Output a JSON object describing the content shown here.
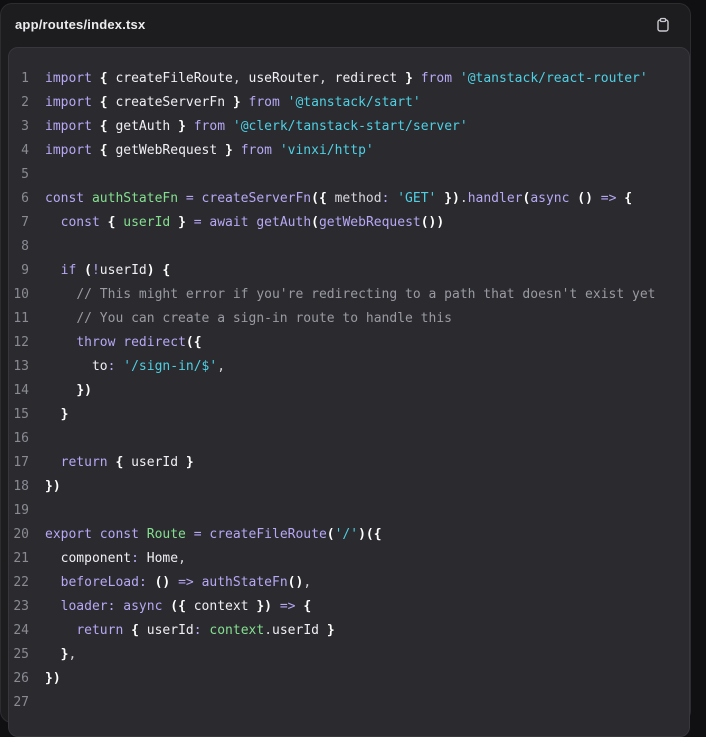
{
  "header": {
    "filename": "app/routes/index.tsx",
    "copy_icon": "clipboard-icon"
  },
  "colors": {
    "keyword": "#b8a8f5",
    "string": "#4fd0e3",
    "comment": "#9a9aa3",
    "variable": "#84e08f",
    "plain": "#d6d6dc",
    "background": "#2a2a2f"
  },
  "code": {
    "lines": [
      {
        "n": "1",
        "tokens": [
          [
            "kw",
            "import "
          ],
          [
            "br",
            "{ "
          ],
          [
            "fn",
            "createFileRoute"
          ],
          [
            "pl",
            ", "
          ],
          [
            "fn",
            "useRouter"
          ],
          [
            "pl",
            ", "
          ],
          [
            "fn",
            "redirect "
          ],
          [
            "br",
            "} "
          ],
          [
            "kw",
            "from "
          ],
          [
            "str",
            "'@tanstack/react-router'"
          ]
        ]
      },
      {
        "n": "2",
        "tokens": [
          [
            "kw",
            "import "
          ],
          [
            "br",
            "{ "
          ],
          [
            "fn",
            "createServerFn "
          ],
          [
            "br",
            "} "
          ],
          [
            "kw",
            "from "
          ],
          [
            "str",
            "'@tanstack/start'"
          ]
        ]
      },
      {
        "n": "3",
        "tokens": [
          [
            "kw",
            "import "
          ],
          [
            "br",
            "{ "
          ],
          [
            "fn",
            "getAuth "
          ],
          [
            "br",
            "} "
          ],
          [
            "kw",
            "from "
          ],
          [
            "str",
            "'@clerk/tanstack-start/server'"
          ]
        ]
      },
      {
        "n": "4",
        "tokens": [
          [
            "kw",
            "import "
          ],
          [
            "br",
            "{ "
          ],
          [
            "fn",
            "getWebRequest "
          ],
          [
            "br",
            "} "
          ],
          [
            "kw",
            "from "
          ],
          [
            "str",
            "'vinxi/http'"
          ]
        ]
      },
      {
        "n": "5",
        "tokens": []
      },
      {
        "n": "6",
        "tokens": [
          [
            "kw",
            "const "
          ],
          [
            "var",
            "authStateFn "
          ],
          [
            "kw",
            "= "
          ],
          [
            "kw",
            "createServerFn"
          ],
          [
            "br",
            "({ "
          ],
          [
            "pl",
            "method"
          ],
          [
            "kw",
            ": "
          ],
          [
            "str",
            "'GET' "
          ],
          [
            "br",
            "})"
          ],
          [
            "pl",
            "."
          ],
          [
            "kw",
            "handler"
          ],
          [
            "br",
            "("
          ],
          [
            "kw",
            "async "
          ],
          [
            "br",
            "() "
          ],
          [
            "kw",
            "=> "
          ],
          [
            "br",
            "{"
          ]
        ]
      },
      {
        "n": "7",
        "tokens": [
          [
            "pl",
            "  "
          ],
          [
            "kw",
            "const "
          ],
          [
            "br",
            "{ "
          ],
          [
            "var",
            "userId "
          ],
          [
            "br",
            "} "
          ],
          [
            "kw",
            "= await "
          ],
          [
            "kw",
            "getAuth"
          ],
          [
            "br",
            "("
          ],
          [
            "kw",
            "getWebRequest"
          ],
          [
            "br",
            "())"
          ]
        ]
      },
      {
        "n": "8",
        "tokens": []
      },
      {
        "n": "9",
        "tokens": [
          [
            "pl",
            "  "
          ],
          [
            "kw",
            "if "
          ],
          [
            "br",
            "("
          ],
          [
            "kw",
            "!"
          ],
          [
            "fn",
            "userId"
          ],
          [
            "br",
            ") {"
          ]
        ]
      },
      {
        "n": "10",
        "tokens": [
          [
            "pl",
            "    "
          ],
          [
            "cm",
            "// This might error if you're redirecting to a path that doesn't exist yet"
          ]
        ]
      },
      {
        "n": "11",
        "tokens": [
          [
            "pl",
            "    "
          ],
          [
            "cm",
            "// You can create a sign-in route to handle this"
          ]
        ]
      },
      {
        "n": "12",
        "tokens": [
          [
            "pl",
            "    "
          ],
          [
            "kw",
            "throw "
          ],
          [
            "kw",
            "redirect"
          ],
          [
            "br",
            "({"
          ]
        ]
      },
      {
        "n": "13",
        "tokens": [
          [
            "pl",
            "      "
          ],
          [
            "fn",
            "to"
          ],
          [
            "kw",
            ": "
          ],
          [
            "str",
            "'/sign-in/$'"
          ],
          [
            "pl",
            ","
          ]
        ]
      },
      {
        "n": "14",
        "tokens": [
          [
            "pl",
            "    "
          ],
          [
            "br",
            "})"
          ]
        ]
      },
      {
        "n": "15",
        "tokens": [
          [
            "pl",
            "  "
          ],
          [
            "br",
            "}"
          ]
        ]
      },
      {
        "n": "16",
        "tokens": []
      },
      {
        "n": "17",
        "tokens": [
          [
            "pl",
            "  "
          ],
          [
            "kw",
            "return "
          ],
          [
            "br",
            "{ "
          ],
          [
            "fn",
            "userId "
          ],
          [
            "br",
            "}"
          ]
        ]
      },
      {
        "n": "18",
        "tokens": [
          [
            "br",
            "})"
          ]
        ]
      },
      {
        "n": "19",
        "tokens": []
      },
      {
        "n": "20",
        "tokens": [
          [
            "kw",
            "export const "
          ],
          [
            "var",
            "Route "
          ],
          [
            "kw",
            "= "
          ],
          [
            "kw",
            "createFileRoute"
          ],
          [
            "br",
            "("
          ],
          [
            "str",
            "'/'"
          ],
          [
            "br",
            ")({"
          ]
        ]
      },
      {
        "n": "21",
        "tokens": [
          [
            "pl",
            "  "
          ],
          [
            "fn",
            "component"
          ],
          [
            "kw",
            ": "
          ],
          [
            "fn",
            "Home"
          ],
          [
            "pl",
            ","
          ]
        ]
      },
      {
        "n": "22",
        "tokens": [
          [
            "pl",
            "  "
          ],
          [
            "kw",
            "beforeLoad"
          ],
          [
            "kw",
            ": "
          ],
          [
            "br",
            "() "
          ],
          [
            "kw",
            "=> "
          ],
          [
            "kw",
            "authStateFn"
          ],
          [
            "br",
            "()"
          ],
          [
            "pl",
            ","
          ]
        ]
      },
      {
        "n": "23",
        "tokens": [
          [
            "pl",
            "  "
          ],
          [
            "kw",
            "loader"
          ],
          [
            "kw",
            ": async "
          ],
          [
            "br",
            "({ "
          ],
          [
            "fn",
            "context "
          ],
          [
            "br",
            "}) "
          ],
          [
            "kw",
            "=> "
          ],
          [
            "br",
            "{"
          ]
        ]
      },
      {
        "n": "24",
        "tokens": [
          [
            "pl",
            "    "
          ],
          [
            "kw",
            "return "
          ],
          [
            "br",
            "{ "
          ],
          [
            "fn",
            "userId"
          ],
          [
            "kw",
            ": "
          ],
          [
            "var",
            "context"
          ],
          [
            "pl",
            "."
          ],
          [
            "fn",
            "userId "
          ],
          [
            "br",
            "}"
          ]
        ]
      },
      {
        "n": "25",
        "tokens": [
          [
            "pl",
            "  "
          ],
          [
            "br",
            "}"
          ],
          [
            "pl",
            ","
          ]
        ]
      },
      {
        "n": "26",
        "tokens": [
          [
            "br",
            "})"
          ]
        ]
      },
      {
        "n": "27",
        "tokens": []
      }
    ]
  }
}
